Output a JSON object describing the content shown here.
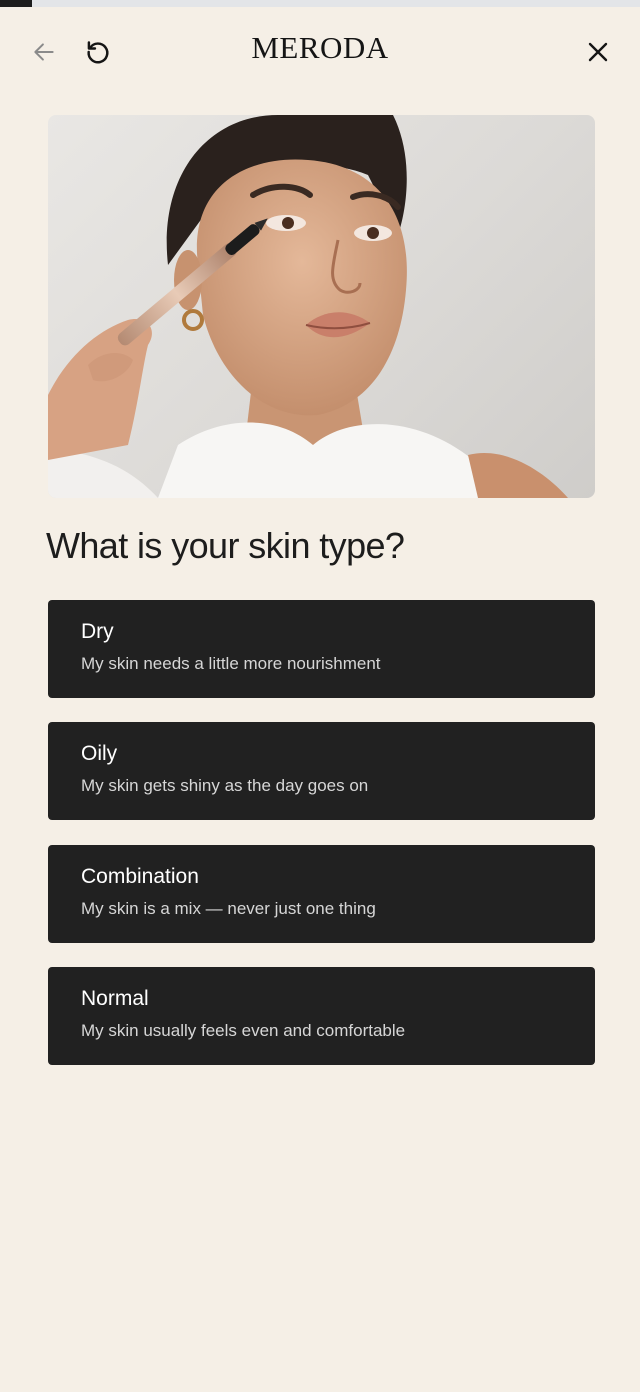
{
  "progress": {
    "fraction": 0.05
  },
  "header": {
    "logo": "MERODA",
    "back_icon": "arrow-left-icon",
    "restart_icon": "restart-icon",
    "close_icon": "close-icon"
  },
  "hero": {
    "image": "woman-applying-eyeliner-photo"
  },
  "quiz": {
    "question": "What is your skin type?",
    "options": [
      {
        "title": "Dry",
        "description": "My skin needs a little more nourishment"
      },
      {
        "title": "Oily",
        "description": "My skin gets shiny as the day goes on"
      },
      {
        "title": "Combination",
        "description": "My skin is a mix — never just one thing"
      },
      {
        "title": "Normal",
        "description": "My skin usually feels even and comfortable"
      }
    ]
  },
  "colors": {
    "background": "#f5efe6",
    "option_background": "#212121",
    "option_text": "#ffffff"
  }
}
